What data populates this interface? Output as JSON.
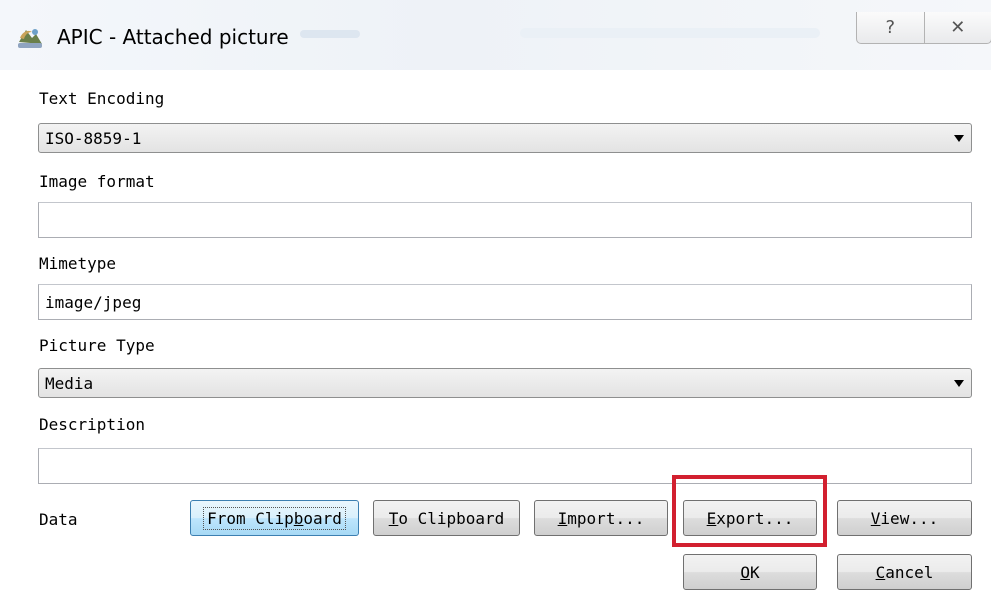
{
  "window": {
    "title": "APIC - Attached picture",
    "help_glyph": "?",
    "close_glyph": "✕"
  },
  "form": {
    "text_encoding": {
      "label": "Text Encoding",
      "value": "ISO-8859-1"
    },
    "image_format": {
      "label": "Image format",
      "value": ""
    },
    "mimetype": {
      "label": "Mimetype",
      "value": "image/jpeg"
    },
    "picture_type": {
      "label": "Picture Type",
      "value": "Media"
    },
    "description": {
      "label": "Description",
      "value": ""
    },
    "data_label": "Data"
  },
  "buttons": {
    "from_clipboard": {
      "pre": "From Clip",
      "key": "b",
      "post": "oard"
    },
    "to_clipboard": {
      "pre": "",
      "key": "T",
      "post": "o Clipboard"
    },
    "import": {
      "pre": "",
      "key": "I",
      "post": "mport..."
    },
    "export": {
      "pre": "",
      "key": "E",
      "post": "xport..."
    },
    "view": {
      "pre": "",
      "key": "V",
      "post": "iew..."
    },
    "ok": {
      "pre": "",
      "key": "O",
      "post": "K"
    },
    "cancel": {
      "pre": "",
      "key": "C",
      "post": "ancel"
    }
  },
  "colors": {
    "highlight": "#d2202f",
    "focus_border": "#3c7fb1"
  },
  "icons": {
    "app": "picture-app-icon",
    "help": "help-icon",
    "close": "close-icon",
    "dropdown": "chevron-down-icon"
  }
}
